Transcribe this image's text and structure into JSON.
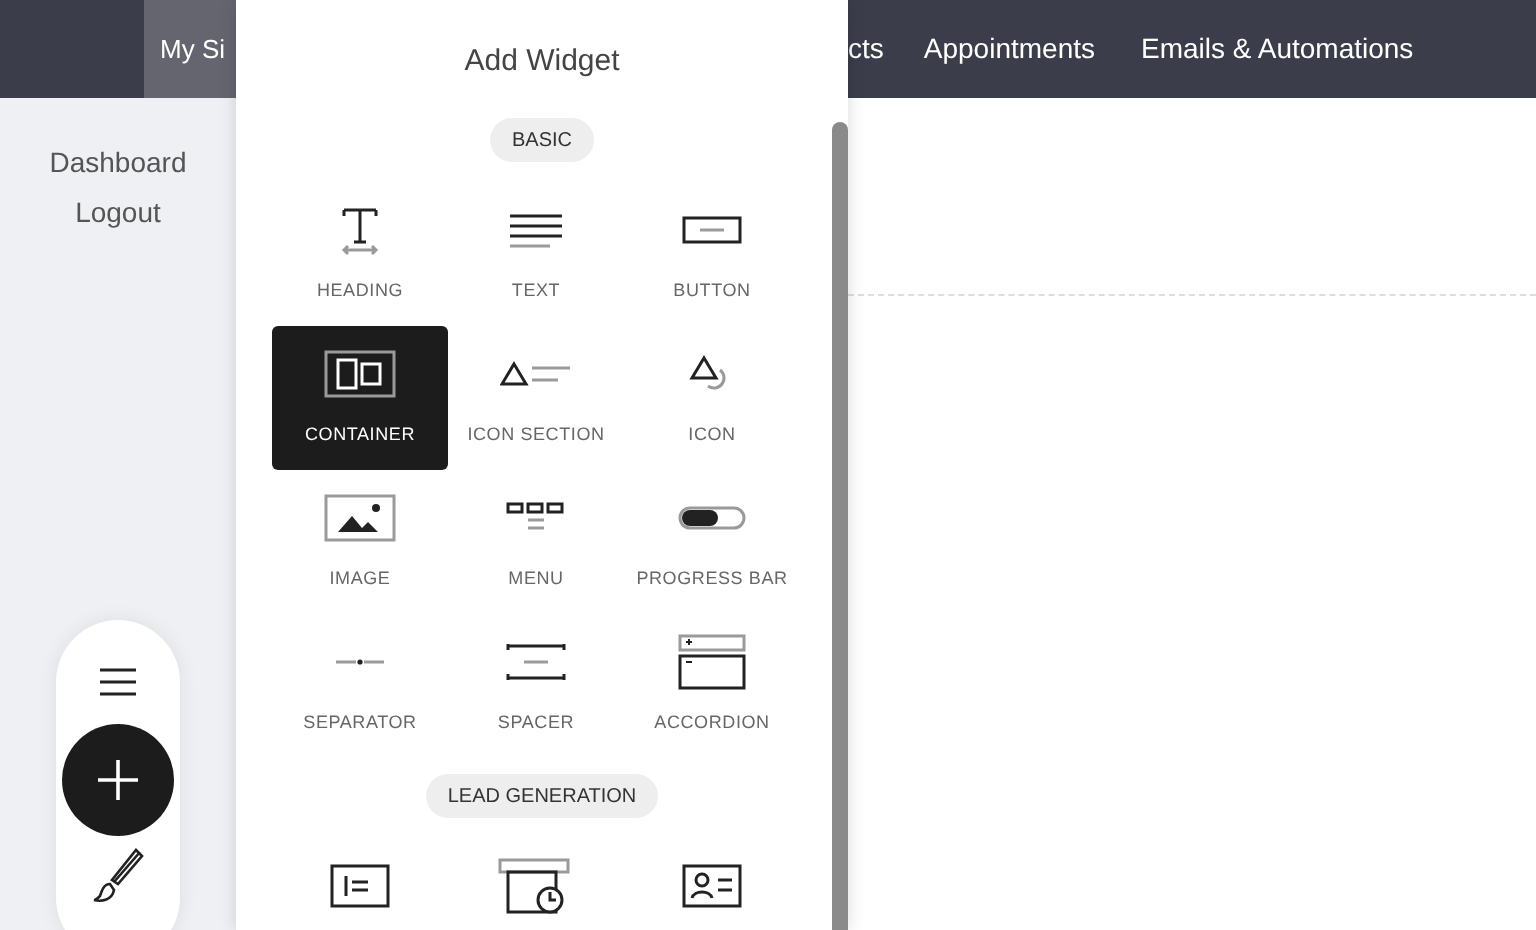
{
  "nav": [
    {
      "label": "My Si",
      "selected": true
    },
    {
      "label": "cts",
      "selected": false
    },
    {
      "label": "Appointments",
      "selected": false
    },
    {
      "label": "Emails & Automations",
      "selected": false
    }
  ],
  "sidebar": {
    "items": [
      "Dashboard",
      "Logout"
    ]
  },
  "panel": {
    "title": "Add Widget",
    "sections": [
      {
        "label": "BASIC",
        "widgets": [
          {
            "kind": "heading",
            "label": "HEADING",
            "selected": false
          },
          {
            "kind": "text",
            "label": "TEXT",
            "selected": false
          },
          {
            "kind": "button",
            "label": "BUTTON",
            "selected": false
          },
          {
            "kind": "container",
            "label": "CONTAINER",
            "selected": true
          },
          {
            "kind": "iconsection",
            "label": "ICON SECTION",
            "selected": false
          },
          {
            "kind": "icon",
            "label": "ICON",
            "selected": false
          },
          {
            "kind": "image",
            "label": "IMAGE",
            "selected": false
          },
          {
            "kind": "menu",
            "label": "MENU",
            "selected": false
          },
          {
            "kind": "progress",
            "label": "PROGRESS BAR",
            "selected": false
          },
          {
            "kind": "separator",
            "label": "SEPARATOR",
            "selected": false
          },
          {
            "kind": "spacer",
            "label": "SPACER",
            "selected": false
          },
          {
            "kind": "accordion",
            "label": "ACCORDION",
            "selected": false
          }
        ]
      },
      {
        "label": "LEAD GENERATION",
        "widgets": [
          {
            "kind": "form",
            "selected": false
          },
          {
            "kind": "booking",
            "selected": false
          },
          {
            "kind": "contact",
            "selected": false
          }
        ]
      }
    ]
  }
}
